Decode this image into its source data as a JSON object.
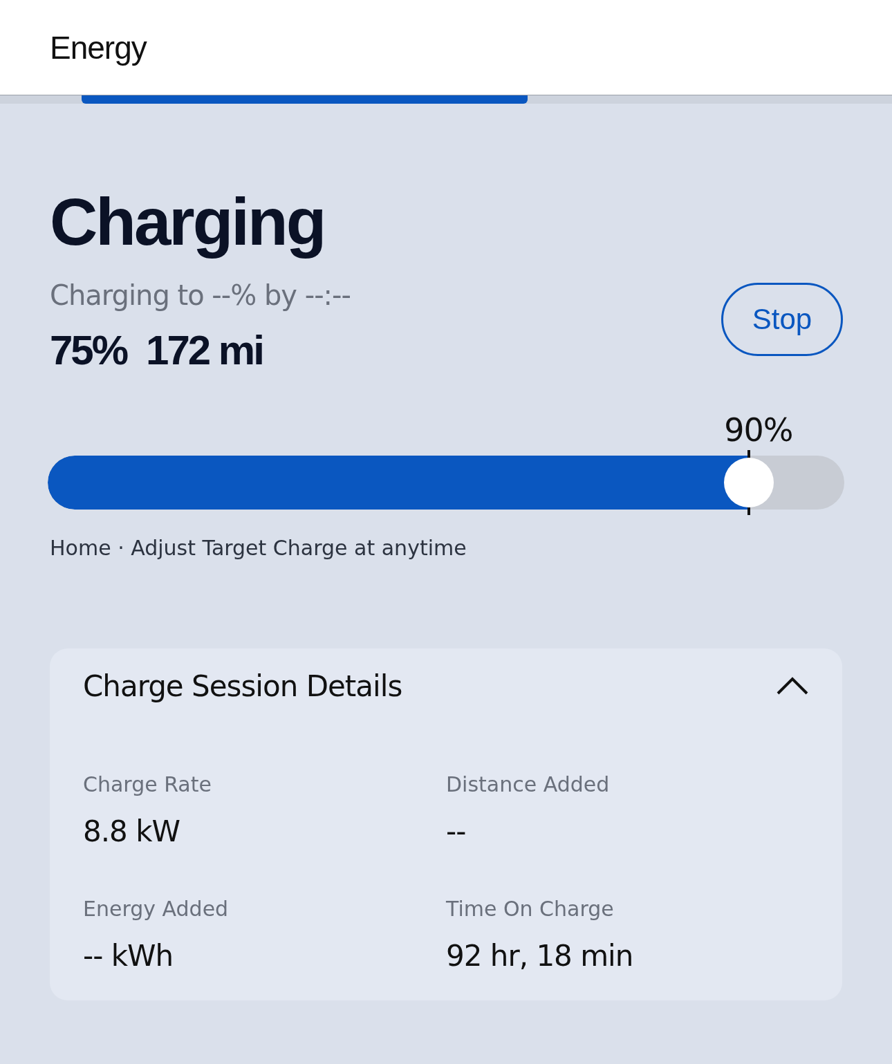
{
  "header": {
    "title": "Energy"
  },
  "status": {
    "title": "Charging",
    "subtitle": "Charging to --% by --:--",
    "battery": "75%",
    "range": "172 mi",
    "stop_button": "Stop"
  },
  "target_slider": {
    "reading": "90%",
    "level": 0.88,
    "caption": "Home · Adjust Target Charge at anytime"
  },
  "details": {
    "title": "Charge Session Details",
    "expanded": true,
    "items": [
      {
        "label": "Charge Rate",
        "value": "8.8 kW"
      },
      {
        "label": "Distance Added",
        "value": "--"
      },
      {
        "label": "Energy Added",
        "value": "-- kWh"
      },
      {
        "label": "Time On Charge",
        "value": "92 hr, 18 min"
      }
    ]
  }
}
